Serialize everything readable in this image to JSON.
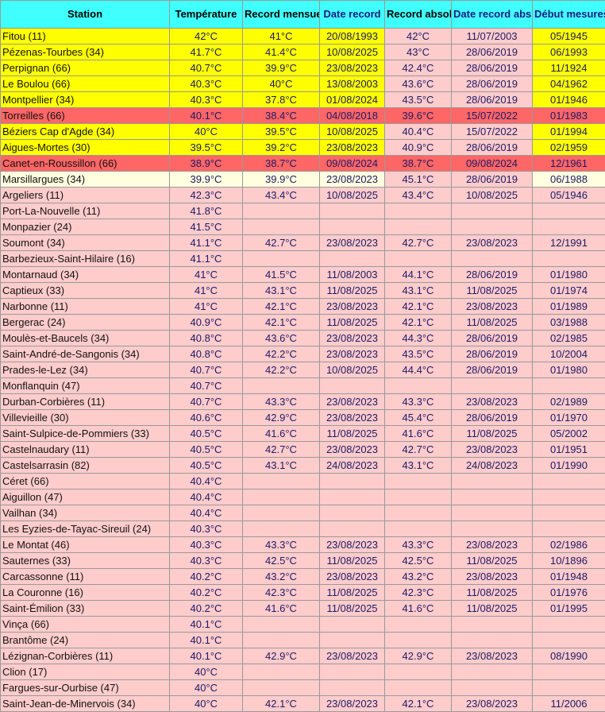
{
  "headers": {
    "station": "Station",
    "temp": "Température",
    "rec_m": "Record mensuel",
    "date_rec": "Date record",
    "rec_abs": "Record absolu",
    "date_abs": "Date record abs.",
    "debut": "Début mesures"
  },
  "colors": {
    "header": "#40ffff",
    "hot": "#ffff00",
    "record": "#ff6666",
    "near": "#ffffe0",
    "normal": "#ffcccc"
  },
  "rows": [
    {
      "s": "hot",
      "c": [
        "Fitou (11)",
        "42°C",
        "41°C",
        "20/08/1993",
        "42°C",
        "11/07/2003",
        "05/1945"
      ]
    },
    {
      "s": "hot",
      "c": [
        "Pézenas-Tourbes (34)",
        "41.7°C",
        "41.4°C",
        "10/08/2025",
        "43°C",
        "28/06/2019",
        "06/1993"
      ]
    },
    {
      "s": "hot",
      "c": [
        "Perpignan (66)",
        "40.7°C",
        "39.9°C",
        "23/08/2023",
        "42.4°C",
        "28/06/2019",
        "11/1924"
      ]
    },
    {
      "s": "hot",
      "c": [
        "Le Boulou (66)",
        "40.3°C",
        "40°C",
        "13/08/2003",
        "43.6°C",
        "28/06/2019",
        "04/1962"
      ]
    },
    {
      "s": "hot",
      "c": [
        "Montpellier (34)",
        "40.3°C",
        "37.8°C",
        "01/08/2024",
        "43.5°C",
        "28/06/2019",
        "01/1946"
      ]
    },
    {
      "s": "record",
      "c": [
        "Torreilles (66)",
        "40.1°C",
        "38.4°C",
        "04/08/2018",
        "39.6°C",
        "15/07/2022",
        "01/1983"
      ]
    },
    {
      "s": "hot",
      "c": [
        "Béziers Cap d'Agde (34)",
        "40°C",
        "39.5°C",
        "10/08/2025",
        "40.4°C",
        "15/07/2022",
        "01/1994"
      ]
    },
    {
      "s": "hot",
      "c": [
        "Aigues-Mortes (30)",
        "39.5°C",
        "39.2°C",
        "23/08/2023",
        "40.9°C",
        "28/06/2019",
        "02/1959"
      ]
    },
    {
      "s": "record",
      "c": [
        "Canet-en-Roussillon (66)",
        "38.9°C",
        "38.7°C",
        "09/08/2024",
        "38.7°C",
        "09/08/2024",
        "12/1961"
      ]
    },
    {
      "s": "near",
      "c": [
        "Marsillargues (34)",
        "39.9°C",
        "39.9°C",
        "23/08/2023",
        "45.1°C",
        "28/06/2019",
        "06/1988"
      ]
    },
    {
      "s": "normal",
      "c": [
        "Argeliers (11)",
        "42.3°C",
        "43.4°C",
        "10/08/2025",
        "43.4°C",
        "10/08/2025",
        "05/1946"
      ]
    },
    {
      "s": "normal",
      "c": [
        "Port-La-Nouvelle (11)",
        "41.8°C",
        "",
        "",
        "",
        "",
        ""
      ]
    },
    {
      "s": "normal",
      "c": [
        "Monpazier (24)",
        "41.5°C",
        "",
        "",
        "",
        "",
        ""
      ]
    },
    {
      "s": "normal",
      "c": [
        "Soumont (34)",
        "41.1°C",
        "42.7°C",
        "23/08/2023",
        "42.7°C",
        "23/08/2023",
        "12/1991"
      ]
    },
    {
      "s": "normal",
      "c": [
        "Barbezieux-Saint-Hilaire (16)",
        "41.1°C",
        "",
        "",
        "",
        "",
        ""
      ]
    },
    {
      "s": "normal",
      "c": [
        "Montarnaud (34)",
        "41°C",
        "41.5°C",
        "11/08/2003",
        "44.1°C",
        "28/06/2019",
        "01/1980"
      ]
    },
    {
      "s": "normal",
      "c": [
        "Captieux (33)",
        "41°C",
        "43.1°C",
        "11/08/2025",
        "43.1°C",
        "11/08/2025",
        "01/1974"
      ]
    },
    {
      "s": "normal",
      "c": [
        "Narbonne (11)",
        "41°C",
        "42.1°C",
        "23/08/2023",
        "42.1°C",
        "23/08/2023",
        "01/1989"
      ]
    },
    {
      "s": "normal",
      "c": [
        "Bergerac (24)",
        "40.9°C",
        "42.1°C",
        "11/08/2025",
        "42.1°C",
        "11/08/2025",
        "03/1988"
      ]
    },
    {
      "s": "normal",
      "c": [
        "Moulès-et-Baucels (34)",
        "40.8°C",
        "43.6°C",
        "23/08/2023",
        "44.3°C",
        "28/06/2019",
        "02/1985"
      ]
    },
    {
      "s": "normal",
      "c": [
        "Saint-André-de-Sangonis (34)",
        "40.8°C",
        "42.2°C",
        "23/08/2023",
        "43.5°C",
        "28/06/2019",
        "10/2004"
      ]
    },
    {
      "s": "normal",
      "c": [
        "Prades-le-Lez (34)",
        "40.7°C",
        "42.2°C",
        "10/08/2025",
        "44.4°C",
        "28/06/2019",
        "01/1980"
      ]
    },
    {
      "s": "normal",
      "c": [
        "Monflanquin (47)",
        "40.7°C",
        "",
        "",
        "",
        "",
        ""
      ]
    },
    {
      "s": "normal",
      "c": [
        "Durban-Corbières (11)",
        "40.7°C",
        "43.3°C",
        "23/08/2023",
        "43.3°C",
        "23/08/2023",
        "02/1989"
      ]
    },
    {
      "s": "normal",
      "c": [
        "Villevieille (30)",
        "40.6°C",
        "42.9°C",
        "23/08/2023",
        "45.4°C",
        "28/06/2019",
        "01/1970"
      ]
    },
    {
      "s": "normal",
      "c": [
        "Saint-Sulpice-de-Pommiers (33)",
        "40.5°C",
        "41.6°C",
        "11/08/2025",
        "41.6°C",
        "11/08/2025",
        "05/2002"
      ]
    },
    {
      "s": "normal",
      "c": [
        "Castelnaudary (11)",
        "40.5°C",
        "42.7°C",
        "23/08/2023",
        "42.7°C",
        "23/08/2023",
        "01/1951"
      ]
    },
    {
      "s": "normal",
      "c": [
        "Castelsarrasin (82)",
        "40.5°C",
        "43.1°C",
        "24/08/2023",
        "43.1°C",
        "24/08/2023",
        "01/1990"
      ]
    },
    {
      "s": "normal",
      "c": [
        "Céret (66)",
        "40.4°C",
        "",
        "",
        "",
        "",
        ""
      ]
    },
    {
      "s": "normal",
      "c": [
        "Aiguillon (47)",
        "40.4°C",
        "",
        "",
        "",
        "",
        ""
      ]
    },
    {
      "s": "normal",
      "c": [
        "Vailhan (34)",
        "40.4°C",
        "",
        "",
        "",
        "",
        ""
      ]
    },
    {
      "s": "normal",
      "c": [
        "Les Eyzies-de-Tayac-Sireuil (24)",
        "40.3°C",
        "",
        "",
        "",
        "",
        ""
      ]
    },
    {
      "s": "normal",
      "c": [
        "Le Montat (46)",
        "40.3°C",
        "43.3°C",
        "23/08/2023",
        "43.3°C",
        "23/08/2023",
        "02/1986"
      ]
    },
    {
      "s": "normal",
      "c": [
        "Sauternes (33)",
        "40.3°C",
        "42.5°C",
        "11/08/2025",
        "42.5°C",
        "11/08/2025",
        "10/1896"
      ]
    },
    {
      "s": "normal",
      "c": [
        "Carcassonne (11)",
        "40.2°C",
        "43.2°C",
        "23/08/2023",
        "43.2°C",
        "23/08/2023",
        "01/1948"
      ]
    },
    {
      "s": "normal",
      "c": [
        "La Couronne (16)",
        "40.2°C",
        "42.3°C",
        "11/08/2025",
        "42.3°C",
        "11/08/2025",
        "01/1976"
      ]
    },
    {
      "s": "normal",
      "c": [
        "Saint-Émilion (33)",
        "40.2°C",
        "41.6°C",
        "11/08/2025",
        "41.6°C",
        "11/08/2025",
        "01/1995"
      ]
    },
    {
      "s": "normal",
      "c": [
        "Vinça (66)",
        "40.1°C",
        "",
        "",
        "",
        "",
        ""
      ]
    },
    {
      "s": "normal",
      "c": [
        "Brantôme (24)",
        "40.1°C",
        "",
        "",
        "",
        "",
        ""
      ]
    },
    {
      "s": "normal",
      "c": [
        "Lézignan-Corbières (11)",
        "40.1°C",
        "42.9°C",
        "23/08/2023",
        "42.9°C",
        "23/08/2023",
        "08/1990"
      ]
    },
    {
      "s": "normal",
      "c": [
        "Clion (17)",
        "40°C",
        "",
        "",
        "",
        "",
        ""
      ]
    },
    {
      "s": "normal",
      "c": [
        "Fargues-sur-Ourbise (47)",
        "40°C",
        "",
        "",
        "",
        "",
        ""
      ]
    },
    {
      "s": "normal",
      "c": [
        "Saint-Jean-de-Minervois (34)",
        "40°C",
        "42.1°C",
        "23/08/2023",
        "42.1°C",
        "23/08/2023",
        "11/2006"
      ]
    }
  ]
}
